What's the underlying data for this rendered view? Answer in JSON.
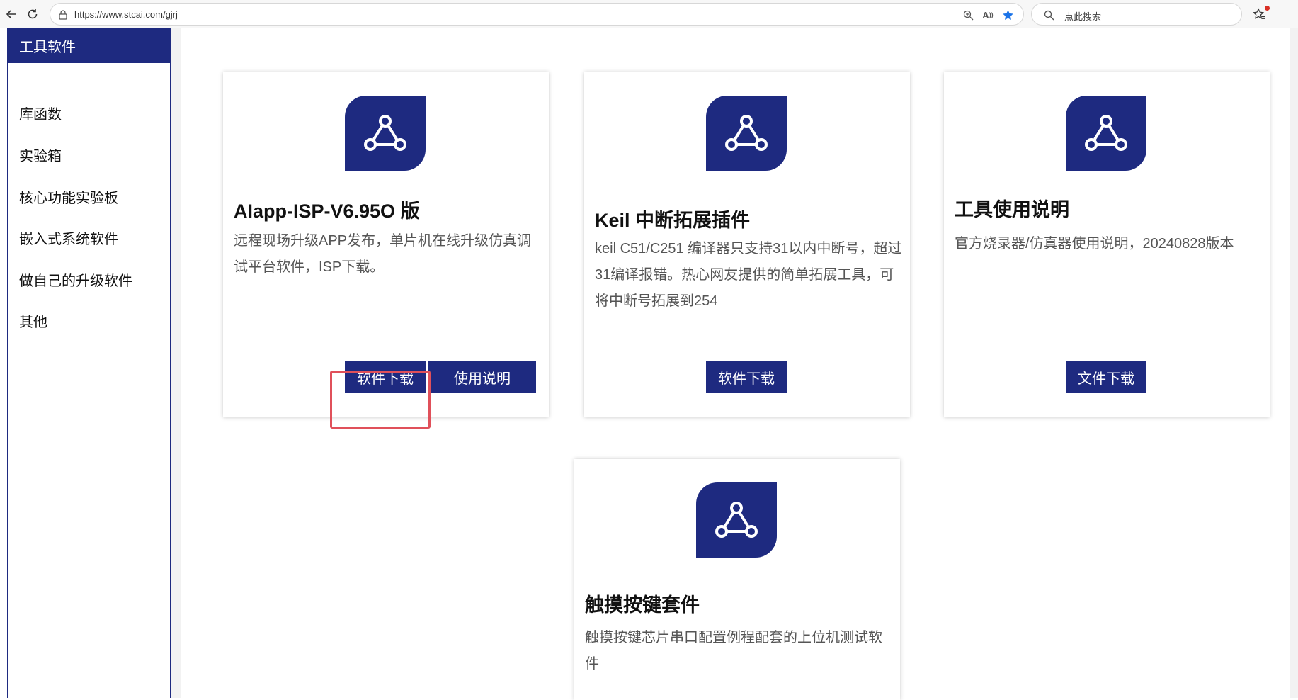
{
  "browser": {
    "url": "https://www.stcai.com/gjrj",
    "search_placeholder": "点此搜索",
    "icons": [
      "back-arrow-icon",
      "refresh-icon",
      "site-info-icon",
      "zoom-icon",
      "read-aloud-icon",
      "favorite-star-icon",
      "search-icon",
      "favorites-icon"
    ]
  },
  "sidebar": {
    "items": [
      {
        "label": "工具软件",
        "active": true
      },
      {
        "label": "库函数",
        "active": false
      },
      {
        "label": "实验箱",
        "active": false
      },
      {
        "label": "核心功能实验板",
        "active": false
      },
      {
        "label": "嵌入式系统软件",
        "active": false
      },
      {
        "label": "做自己的升级软件",
        "active": false
      },
      {
        "label": "其他",
        "active": false
      }
    ]
  },
  "cards": [
    {
      "title": "AIapp-ISP-V6.95O 版",
      "description": "远程现场升级APP发布，单片机在线升级仿真调试平台软件，ISP下载。",
      "icon": "share-network-icon",
      "buttons": [
        "软件下载",
        "使用说明"
      ]
    },
    {
      "title": "Keil 中断拓展插件",
      "description": "keil C51/C251 编译器只支持31以内中断号，超过31编译报错。热心网友提供的简单拓展工具，可将中断号拓展到254",
      "icon": "share-network-icon",
      "buttons": [
        "软件下载"
      ]
    },
    {
      "title": "工具使用说明",
      "description": "官方烧录器/仿真器使用说明，20240828版本",
      "icon": "share-network-icon",
      "buttons": [
        "文件下载"
      ]
    },
    {
      "title": "触摸按键套件",
      "description": "触摸按键芯片串口配置例程配套的上位机测试软件",
      "icon": "share-network-icon",
      "buttons": []
    }
  ],
  "colors": {
    "brand_navy": "#1e2a80",
    "highlight_red": "#e0505a"
  }
}
